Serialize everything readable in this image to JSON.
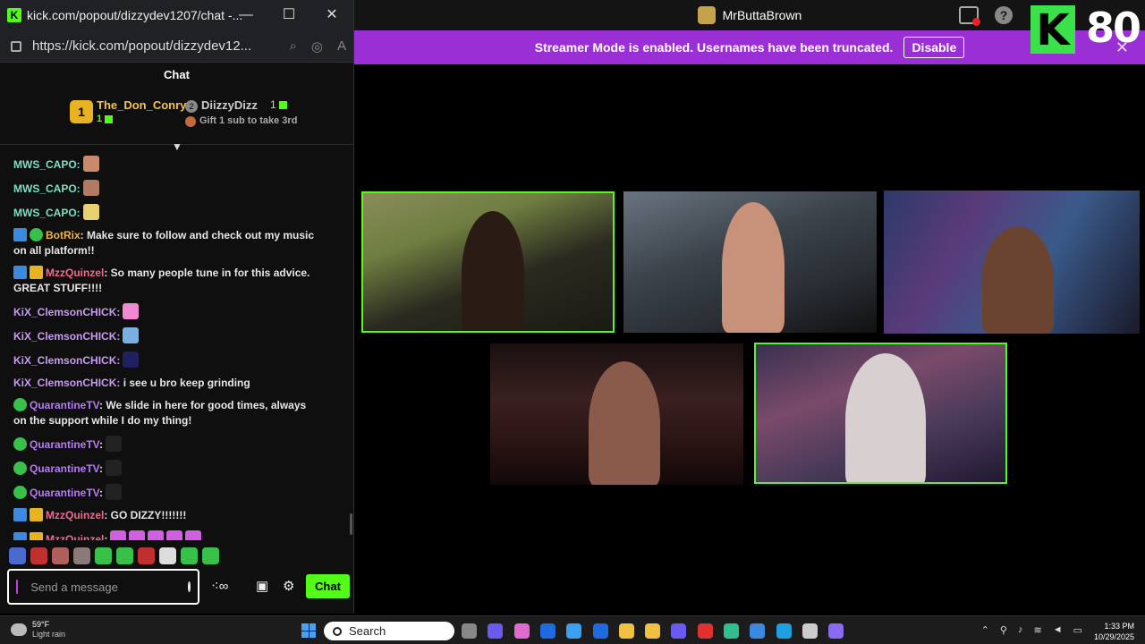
{
  "popout": {
    "title": "kick.com/popout/dizzydev1207/chat -...",
    "url": "https://kick.com/popout/dizzydev12...",
    "minimize": "—",
    "maximize": "☐",
    "close": "✕"
  },
  "chat": {
    "header": "Chat",
    "leaderboard": {
      "first": {
        "rank": "1",
        "name": "The_Don_Conry",
        "count": "1"
      },
      "second": {
        "rank": "2",
        "name": "DiizzyDizz",
        "count": "1"
      },
      "third": {
        "rank": "3",
        "text": "Gift 1 sub to take 3rd"
      }
    },
    "messages": [
      {
        "user": "MWS_CAPO:",
        "text": "",
        "color": "#7de0c4",
        "badges": [],
        "emotes": [
          "#c98a6a"
        ]
      },
      {
        "user": "MWS_CAPO:",
        "text": "",
        "color": "#7de0c4",
        "badges": [],
        "emotes": [
          "#b07a64"
        ]
      },
      {
        "user": "MWS_CAPO:",
        "text": "",
        "color": "#7de0c4",
        "badges": [],
        "emotes": [
          "#e8d070"
        ]
      },
      {
        "user": "BotRix",
        "text": ": Make sure to follow and check out my music on all platform!!",
        "color": "#f2b33d",
        "badges": [
          "mod",
          "verified"
        ],
        "emotes": []
      },
      {
        "user": "MzzQuinzel",
        "text": ": So many people tune in for this advice. GREAT STUFF!!!!",
        "color": "#f06a8e",
        "badges": [
          "mod",
          "crown"
        ],
        "emotes": []
      },
      {
        "user": "KiX_ClemsonCHICK:",
        "text": "",
        "color": "#c89cf0",
        "badges": [],
        "emotes": [
          "#f08ad0"
        ]
      },
      {
        "user": "KiX_ClemsonCHICK:",
        "text": "",
        "color": "#c89cf0",
        "badges": [],
        "emotes": [
          "#7ab0e0"
        ]
      },
      {
        "user": "KiX_ClemsonCHICK:",
        "text": "",
        "color": "#c89cf0",
        "badges": [],
        "emotes": [
          "#202060"
        ]
      },
      {
        "user": "KiX_ClemsonCHICK:",
        "text": " i see u bro keep grinding",
        "color": "#c89cf0",
        "badges": [],
        "emotes": []
      },
      {
        "user": "QuarantineTV",
        "text": ": We slide in here for good times, always on the support while I do my thing!",
        "color": "#b57cf2",
        "badges": [
          "verified"
        ],
        "emotes": []
      },
      {
        "user": "QuarantineTV",
        "text": ":",
        "color": "#b57cf2",
        "badges": [
          "verified"
        ],
        "emotes": [
          "#222"
        ]
      },
      {
        "user": "QuarantineTV",
        "text": ":",
        "color": "#b57cf2",
        "badges": [
          "verified"
        ],
        "emotes": [
          "#222"
        ]
      },
      {
        "user": "QuarantineTV",
        "text": ":",
        "color": "#b57cf2",
        "badges": [
          "verified"
        ],
        "emotes": [
          "#222"
        ]
      },
      {
        "user": "MzzQuinzel",
        "text": ": GO DIZZY!!!!!!!",
        "color": "#f06a8e",
        "badges": [
          "mod",
          "crown"
        ],
        "emotes": []
      },
      {
        "user": "MzzQuinzel",
        "text": ":",
        "color": "#f06a8e",
        "badges": [
          "mod",
          "crown"
        ],
        "emotes": [
          "#d060e0",
          "#d060e0",
          "#d060e0",
          "#d060e0",
          "#d060e0"
        ]
      }
    ],
    "emote_bar": [
      "#4a6ad0",
      "#c03030",
      "#b0605a",
      "#8a7a7a",
      "#38c14a",
      "#38c14a",
      "#c03030",
      "#dddddd",
      "#38c14a",
      "#38c14a"
    ],
    "input_placeholder": "Send a message",
    "send_label": "Chat"
  },
  "app": {
    "title": "MrButtaBrown",
    "help": "?",
    "streamer_banner": "Streamer Mode is enabled. Usernames have been truncated.",
    "disable_label": "Disable",
    "banner_close": "✕",
    "kick_logo": "K",
    "viewer_count": "80"
  },
  "taskbar": {
    "temp": "59°F",
    "condition": "Light rain",
    "search": "Search",
    "time": "1:33 PM",
    "date": "10/29/2025",
    "apps": [
      "#888",
      "#6a5af0",
      "#e06ad0",
      "#1e6ae0",
      "#3aa0f0",
      "#1e6ae0",
      "#f0c040",
      "#f0c040",
      "#6a5af0",
      "#e03030",
      "#30c090",
      "#3a8ae0",
      "#1ea0e0",
      "#cccccc",
      "#8a6af0"
    ]
  },
  "accent": "#53fc18",
  "banner_color": "#9b2fd6"
}
